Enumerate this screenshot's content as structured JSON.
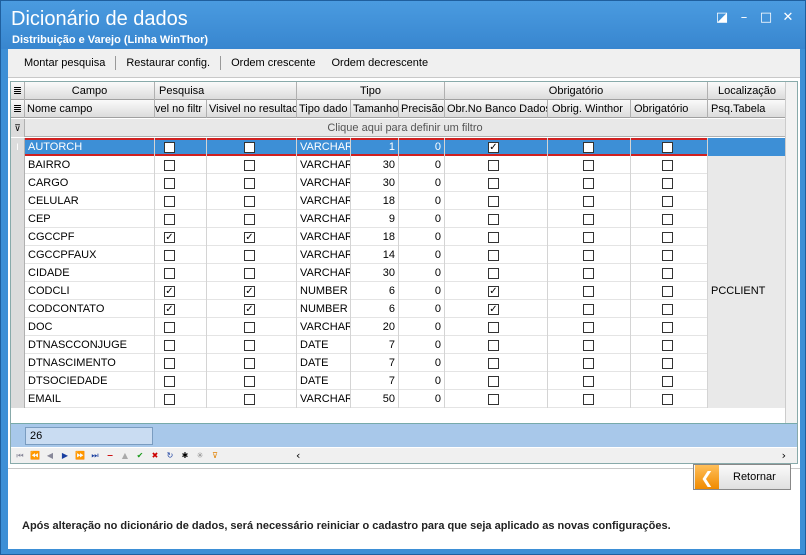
{
  "window": {
    "title": "Dicionário de dados",
    "subtitle": "Distribuição e Varejo (Linha WinThor)",
    "controls": [
      "restore-icon",
      "minimize-icon",
      "maximize-icon",
      "close-icon"
    ]
  },
  "toolbar": {
    "montar_label": "Montar pesquisa",
    "restaurar_label": "Restaurar config.",
    "crescente_label": "Ordem crescente",
    "decrescente_label": "Ordem decrescente"
  },
  "grid": {
    "group_headers": {
      "campo": "Campo",
      "pesquisa": "Pesquisa",
      "tipo": "Tipo",
      "obrigatorio": "Obrigatório",
      "localizacao": "Localização"
    },
    "columns": {
      "nome": "Nome campo",
      "visivel_filtro": "vel no filtr",
      "visivel_result": "Visivel no resultac",
      "tipo_dado": "Tipo dado",
      "tamanho": "Tamanho",
      "precisao": "Precisão",
      "obr_banco": "Obr.No Banco Dados",
      "obr_winthor": "Obrig. Winthor",
      "obrigatorio": "Obrigatório",
      "psq_tabela": "Psq.Tabela"
    },
    "filter_hint": "Clique aqui para definir um filtro",
    "rows": [
      {
        "nome": "AUTORCH",
        "vf": false,
        "vr": false,
        "tipo": "VARCHAR",
        "tam": "1",
        "prec": "0",
        "ob": true,
        "ow": false,
        "o": false,
        "psq": ""
      },
      {
        "nome": "BAIRRO",
        "vf": false,
        "vr": false,
        "tipo": "VARCHAR",
        "tam": "30",
        "prec": "0",
        "ob": false,
        "ow": false,
        "o": false,
        "psq": ""
      },
      {
        "nome": "CARGO",
        "vf": false,
        "vr": false,
        "tipo": "VARCHAR",
        "tam": "30",
        "prec": "0",
        "ob": false,
        "ow": false,
        "o": false,
        "psq": ""
      },
      {
        "nome": "CELULAR",
        "vf": false,
        "vr": false,
        "tipo": "VARCHAR",
        "tam": "18",
        "prec": "0",
        "ob": false,
        "ow": false,
        "o": false,
        "psq": ""
      },
      {
        "nome": "CEP",
        "vf": false,
        "vr": false,
        "tipo": "VARCHAR",
        "tam": "9",
        "prec": "0",
        "ob": false,
        "ow": false,
        "o": false,
        "psq": ""
      },
      {
        "nome": "CGCCPF",
        "vf": true,
        "vr": true,
        "tipo": "VARCHAR",
        "tam": "18",
        "prec": "0",
        "ob": false,
        "ow": false,
        "o": false,
        "psq": ""
      },
      {
        "nome": "CGCCPFAUX",
        "vf": false,
        "vr": false,
        "tipo": "VARCHAR",
        "tam": "14",
        "prec": "0",
        "ob": false,
        "ow": false,
        "o": false,
        "psq": ""
      },
      {
        "nome": "CIDADE",
        "vf": false,
        "vr": false,
        "tipo": "VARCHAR",
        "tam": "30",
        "prec": "0",
        "ob": false,
        "ow": false,
        "o": false,
        "psq": ""
      },
      {
        "nome": "CODCLI",
        "vf": true,
        "vr": true,
        "tipo": "NUMBER",
        "tam": "6",
        "prec": "0",
        "ob": true,
        "ow": false,
        "o": false,
        "psq": "PCCLIENT"
      },
      {
        "nome": "CODCONTATO",
        "vf": true,
        "vr": true,
        "tipo": "NUMBER",
        "tam": "6",
        "prec": "0",
        "ob": true,
        "ow": false,
        "o": false,
        "psq": ""
      },
      {
        "nome": "DOC",
        "vf": false,
        "vr": false,
        "tipo": "VARCHAR",
        "tam": "20",
        "prec": "0",
        "ob": false,
        "ow": false,
        "o": false,
        "psq": ""
      },
      {
        "nome": "DTNASCCONJUGE",
        "vf": false,
        "vr": false,
        "tipo": "DATE",
        "tam": "7",
        "prec": "0",
        "ob": false,
        "ow": false,
        "o": false,
        "psq": ""
      },
      {
        "nome": "DTNASCIMENTO",
        "vf": false,
        "vr": false,
        "tipo": "DATE",
        "tam": "7",
        "prec": "0",
        "ob": false,
        "ow": false,
        "o": false,
        "psq": ""
      },
      {
        "nome": "DTSOCIEDADE",
        "vf": false,
        "vr": false,
        "tipo": "DATE",
        "tam": "7",
        "prec": "0",
        "ob": false,
        "ow": false,
        "o": false,
        "psq": ""
      },
      {
        "nome": "EMAIL",
        "vf": false,
        "vr": false,
        "tipo": "VARCHAR",
        "tam": "50",
        "prec": "0",
        "ob": false,
        "ow": false,
        "o": false,
        "psq": ""
      }
    ],
    "record_count": "26"
  },
  "actions": {
    "retornar_label": "Retornar"
  },
  "note": "Após alteração no dicionário de dados, será necessário reiniciar o cadastro para que seja aplicado as novas configurações.",
  "colors": {
    "title_blue": "#3d8fd6",
    "selection_outline": "#d02020",
    "footer_blue": "#a8c8ea",
    "return_orange": "#f08a00"
  }
}
